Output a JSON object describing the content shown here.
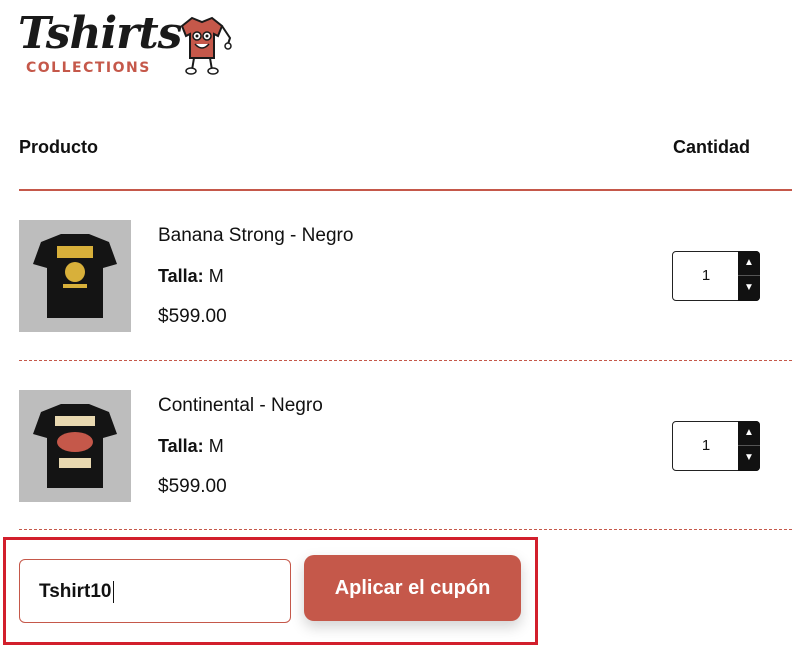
{
  "logo": {
    "title": "Tshirts",
    "subtitle": "COLLECTIONS"
  },
  "table": {
    "header_product": "Producto",
    "header_quantity": "Cantidad"
  },
  "items": [
    {
      "name": "Banana Strong - Negro",
      "size_label": "Talla:",
      "size": "M",
      "price": "$599.00",
      "quantity": "1"
    },
    {
      "name": "Continental - Negro",
      "size_label": "Talla:",
      "size": "M",
      "price": "$599.00",
      "quantity": "1"
    }
  ],
  "coupon": {
    "value": "Tshirt10",
    "apply_label": "Aplicar el cupón"
  },
  "colors": {
    "accent": "#c5584a",
    "highlight": "#d21f2c",
    "text": "#111111"
  }
}
